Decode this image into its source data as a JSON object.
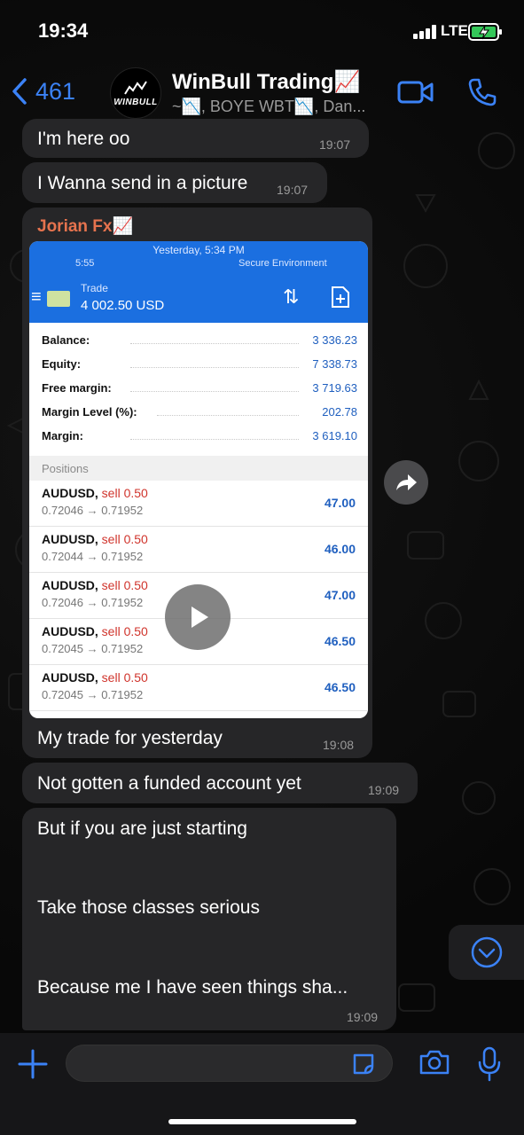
{
  "status_bar": {
    "time": "19:34",
    "network": "LTE"
  },
  "header": {
    "back_count": "461",
    "avatar_text": "WINBULL",
    "title": "WinBull Trading📈",
    "subtitle": "~📉, BOYE WBT📉, Dan..."
  },
  "messages": [
    {
      "text": "I'm here oo",
      "time": "19:07"
    },
    {
      "text": "I Wanna send in a picture",
      "time": "19:07"
    },
    {
      "sender": "Jorian Fx📈",
      "caption": "My trade for yesterday",
      "time": "19:08",
      "media": {
        "date_label": "Yesterday, 5:34 PM",
        "status_time": "5:55",
        "secure_label": "Secure Environment",
        "toolbar_title": "Trade",
        "toolbar_amount": "4 002.50 USD",
        "account": [
          {
            "label": "Balance:",
            "value": "3 336.23"
          },
          {
            "label": "Equity:",
            "value": "7 338.73"
          },
          {
            "label": "Free margin:",
            "value": "3 719.63"
          },
          {
            "label": "Margin Level (%):",
            "value": "202.78"
          },
          {
            "label": "Margin:",
            "value": "3 619.10"
          }
        ],
        "positions_header": "Positions",
        "positions": [
          {
            "symbol": "AUDUSD,",
            "side": "sell 0.50",
            "prices": "0.72046 → 0.71952",
            "profit": "47.00"
          },
          {
            "symbol": "AUDUSD,",
            "side": "sell 0.50",
            "prices": "0.72044 → 0.71952",
            "profit": "46.00"
          },
          {
            "symbol": "AUDUSD,",
            "side": "sell 0.50",
            "prices": "0.72046 → 0.71952",
            "profit": "47.00"
          },
          {
            "symbol": "AUDUSD,",
            "side": "sell 0.50",
            "prices": "0.72045 → 0.71952",
            "profit": "46.50"
          },
          {
            "symbol": "AUDUSD,",
            "side": "sell 0.50",
            "prices": "0.72045 → 0.71952",
            "profit": "46.50"
          }
        ]
      }
    },
    {
      "text": "Not gotten a funded  account yet",
      "time": "19:09"
    },
    {
      "lines": [
        "But if you are just starting",
        "Take those classes serious",
        "Because me I have seen things sha..."
      ],
      "time": "19:09"
    }
  ],
  "input": {
    "placeholder": ""
  },
  "icons": {
    "back": "chevron-left-icon",
    "video": "video-camera-icon",
    "call": "phone-icon",
    "forward": "forward-arrow-icon",
    "play": "play-icon",
    "scroll_down": "chevron-down-circle-icon",
    "attach": "plus-icon",
    "sticker": "sticker-icon",
    "camera": "camera-icon",
    "mic": "microphone-icon"
  },
  "colors": {
    "accent": "#3b82f6",
    "sender": "#e6734e",
    "bubble": "#262628",
    "mt5_blue": "#1b6fe0"
  }
}
